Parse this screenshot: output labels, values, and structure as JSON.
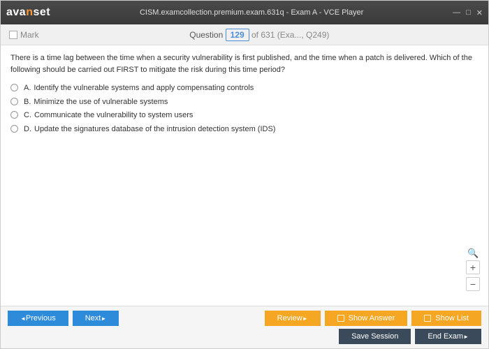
{
  "titlebar": {
    "logo_pre": "ava",
    "logo_mid": "n",
    "logo_post": "set",
    "title": "CISM.examcollection.premium.exam.631q - Exam A - VCE Player"
  },
  "qbar": {
    "mark": "Mark",
    "q_label": "Question",
    "q_num": "129",
    "q_of": "of 631 (Exa..., Q249)"
  },
  "question": {
    "text": "There is a time lag between the time when a security vulnerability is first published, and the time when a patch is delivered. Which of the following should be carried out FIRST to mitigate the risk during this time period?",
    "options": [
      {
        "letter": "A.",
        "text": "Identify the vulnerable systems and apply compensating controls"
      },
      {
        "letter": "B.",
        "text": "Minimize the use of vulnerable systems"
      },
      {
        "letter": "C.",
        "text": "Communicate the vulnerability to system users"
      },
      {
        "letter": "D.",
        "text": "Update the signatures database of the intrusion detection system (IDS)"
      }
    ]
  },
  "zoom": {
    "plus": "+",
    "minus": "−"
  },
  "footer": {
    "previous": "Previous",
    "next": "Next",
    "review": "Review",
    "show_answer": "Show Answer",
    "show_list": "Show List",
    "save_session": "Save Session",
    "end_exam": "End Exam"
  }
}
